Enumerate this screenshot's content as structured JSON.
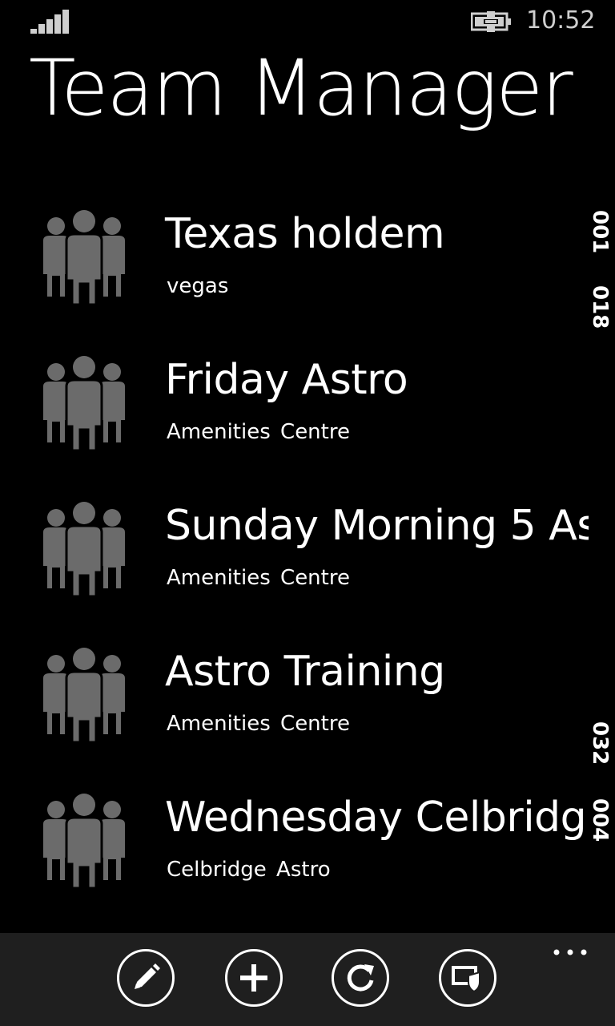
{
  "status_bar": {
    "time": "10:52",
    "signal_icon": "signal-strength-icon",
    "battery_icon": "battery-charging-icon"
  },
  "header": {
    "title": "Team Manager"
  },
  "teams": [
    {
      "name": "Texas holdem",
      "venue": "vegas",
      "icon": "team-people-icon"
    },
    {
      "name": "Friday Astro",
      "venue": "Amenities  Centre",
      "icon": "team-people-icon"
    },
    {
      "name": "Sunday Morning 5 As",
      "venue": "Amenities  Centre",
      "icon": "team-people-icon"
    },
    {
      "name": "Astro Training",
      "venue": "Amenities  Centre",
      "icon": "team-people-icon"
    },
    {
      "name": "Wednesday Celbridge",
      "venue": "Celbridge Astro",
      "icon": "team-people-icon"
    }
  ],
  "side_codes": [
    "001",
    "018",
    "032",
    "004"
  ],
  "app_bar": {
    "buttons": [
      {
        "name": "edit",
        "icon": "pencil-icon"
      },
      {
        "name": "add",
        "icon": "plus-icon"
      },
      {
        "name": "refresh",
        "icon": "refresh-icon"
      },
      {
        "name": "security",
        "icon": "shield-icon"
      }
    ],
    "more_icon": "ellipsis-icon"
  },
  "colors": {
    "background": "#000000",
    "app_bar": "#1f1f1f",
    "icon_gray": "#6b6b6b",
    "text": "#ffffff"
  }
}
